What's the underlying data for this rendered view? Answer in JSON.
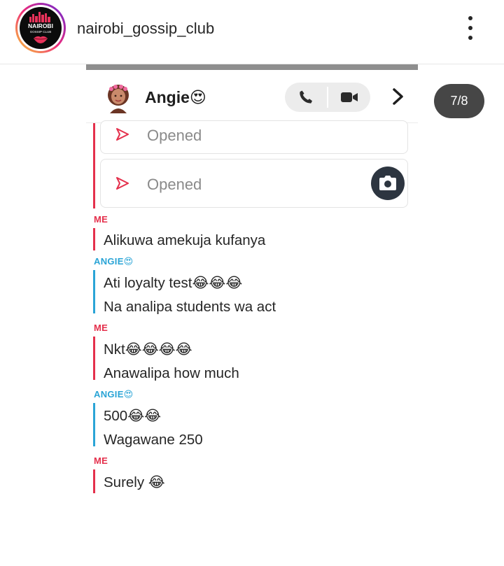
{
  "post": {
    "username": "nairobi_gossip_club",
    "avatar_logo_line1": "NAIROBI",
    "avatar_logo_line2": "GOSSIP CLUB",
    "more_icon": "more-vertical-icon"
  },
  "carousel": {
    "counter": "7/8"
  },
  "chat": {
    "contact_name": "Angie😍",
    "call_icon": "phone-icon",
    "video_icon": "video-camera-icon",
    "forward_icon": "chevron-right-icon",
    "snaps": [
      {
        "status": "Opened",
        "icon": "sent-arrow-icon"
      },
      {
        "status": "Opened",
        "icon": "sent-arrow-icon",
        "action_icon": "camera-icon"
      }
    ],
    "groups": [
      {
        "sender": "ME",
        "messages": [
          "Alikuwa amekuja kufanya"
        ]
      },
      {
        "sender": "ANGIE😍",
        "messages": [
          "Ati loyalty test😂😂😂",
          "Na analipa students wa act"
        ]
      },
      {
        "sender": "ME",
        "messages": [
          "Nkt😂😂😂😂",
          "Anawalipa how much"
        ]
      },
      {
        "sender": "ANGIE😍",
        "messages": [
          "500😂😂",
          "Wagawane 250"
        ]
      },
      {
        "sender": "ME",
        "messages": [
          "Surely 😂"
        ]
      }
    ],
    "colors": {
      "me": "#e4304c",
      "angie": "#2aa4d6",
      "sent_arrow": "#e4304c"
    }
  }
}
